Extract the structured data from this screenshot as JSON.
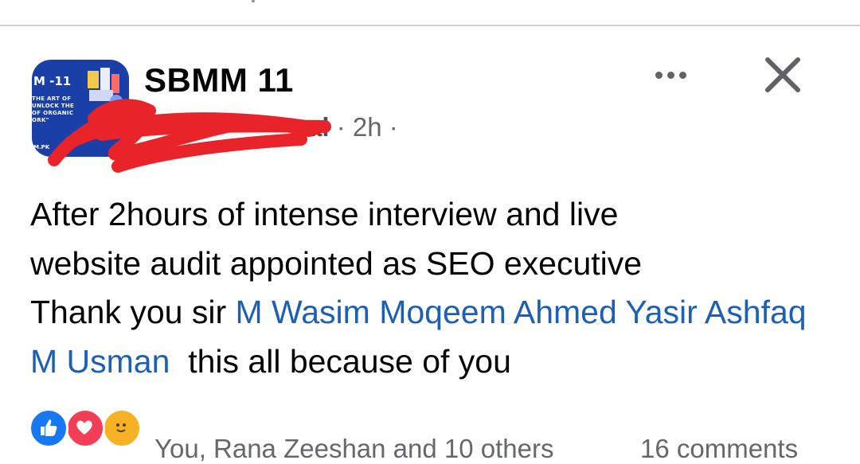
{
  "post": {
    "group_name": "SBMM 11",
    "author_name_partial": "al",
    "separator": "·",
    "timestamp": "2h",
    "trailing_separator": "·",
    "body": {
      "line1": "After 2hours of intense interview and live",
      "line2": "website audit appointed as SEO executive",
      "line3_prefix": "Thank you sir ",
      "mention1": "M Wasim",
      "mention2": "Moqeem Ahmed",
      "mention3": "Yasir Ashfaq",
      "mention4": "M Usman",
      "suffix": "this all because of you"
    },
    "avatar": {
      "title": "M -11",
      "tagline": "THE ART OF\nUNLOCK THE\nOF ORGANIC\nORK\"",
      "url": "M.PK"
    },
    "reactions": {
      "summary": "You, Rana Zeeshan and 10 others",
      "comments": "16 comments",
      "icons": [
        "like-icon",
        "love-icon",
        "care-icon"
      ]
    }
  },
  "colors": {
    "mention": "#1d5fb5",
    "meta": "#65676b",
    "scribble": "#e8242a",
    "avatar_bg": "#1a3fa6"
  }
}
